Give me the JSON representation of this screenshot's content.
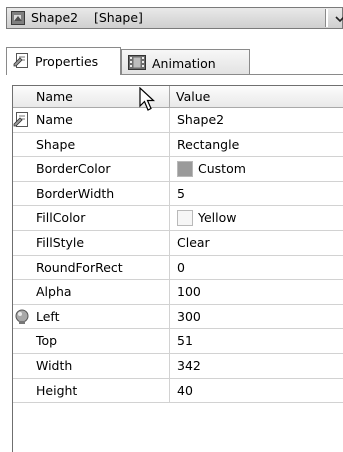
{
  "selector": {
    "text": "Shape2    [Shape]"
  },
  "tabs": [
    {
      "label": "Properties",
      "icon": "properties-icon",
      "active": true
    },
    {
      "label": "Animation",
      "icon": "animation-icon",
      "active": false
    }
  ],
  "grid": {
    "header": {
      "name": "Name",
      "value": "Value"
    },
    "rows": [
      {
        "name": "Name",
        "value": "Shape2",
        "icon": "properties-icon"
      },
      {
        "name": "Shape",
        "value": "Rectangle"
      },
      {
        "name": "BorderColor",
        "value": "Custom",
        "swatch": "#9a9a9a"
      },
      {
        "name": "BorderWidth",
        "value": "5"
      },
      {
        "name": "FillColor",
        "value": "Yellow",
        "swatch": "#f6f6f6"
      },
      {
        "name": "FillStyle",
        "value": "Clear"
      },
      {
        "name": "RoundForRect",
        "value": "0"
      },
      {
        "name": "Alpha",
        "value": "100"
      },
      {
        "name": "Left",
        "value": "300",
        "icon": "position-icon"
      },
      {
        "name": "Top",
        "value": "51"
      },
      {
        "name": "Width",
        "value": "342"
      },
      {
        "name": "Height",
        "value": "40"
      }
    ]
  }
}
